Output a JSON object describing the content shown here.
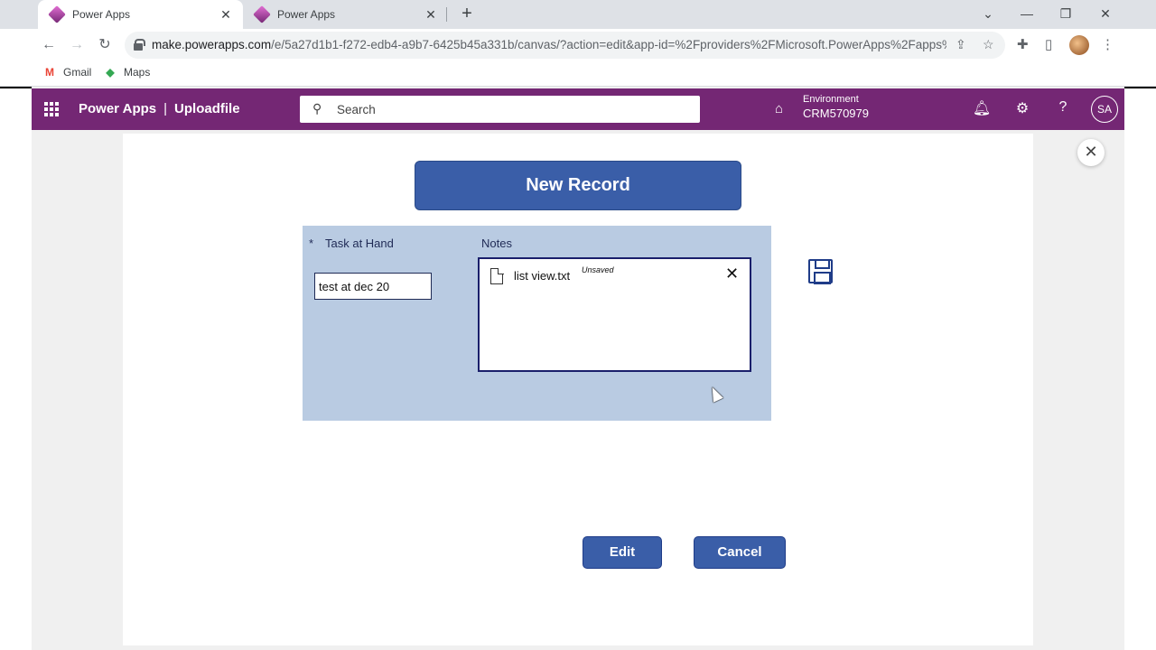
{
  "browser": {
    "tabs": [
      {
        "title": "Power Apps",
        "active": true
      },
      {
        "title": "Power Apps",
        "active": false
      }
    ],
    "new_tab_label": "+",
    "url_host": "make.powerapps.com",
    "url_path": "/e/5a27d1b1-f272-edb4-a9b7-6425b45a331b/canvas/?action=edit&app-id=%2Fproviders%2FMicrosoft.PowerApps%2Fapps%...",
    "bookmarks": [
      {
        "label": "Gmail",
        "icon": "gmail-icon"
      },
      {
        "label": "Maps",
        "icon": "maps-icon"
      }
    ]
  },
  "header": {
    "app_name": "Power Apps",
    "separator": "|",
    "screen_name": "Uploadfile",
    "search_placeholder": "Search",
    "environment_label": "Environment",
    "environment_value": "CRM570979",
    "avatar_initials": "SA",
    "accent_color": "#742774"
  },
  "form": {
    "title": "New Record",
    "required_marker": "*",
    "task_label": "Task at Hand",
    "task_value": "test at dec 20",
    "notes_label": "Notes",
    "attachment": {
      "file_name": "list view.txt",
      "status": "Unsaved"
    },
    "edit_label": "Edit",
    "cancel_label": "Cancel",
    "button_color": "#3a5ea8",
    "panel_color": "#b9cbe2"
  }
}
